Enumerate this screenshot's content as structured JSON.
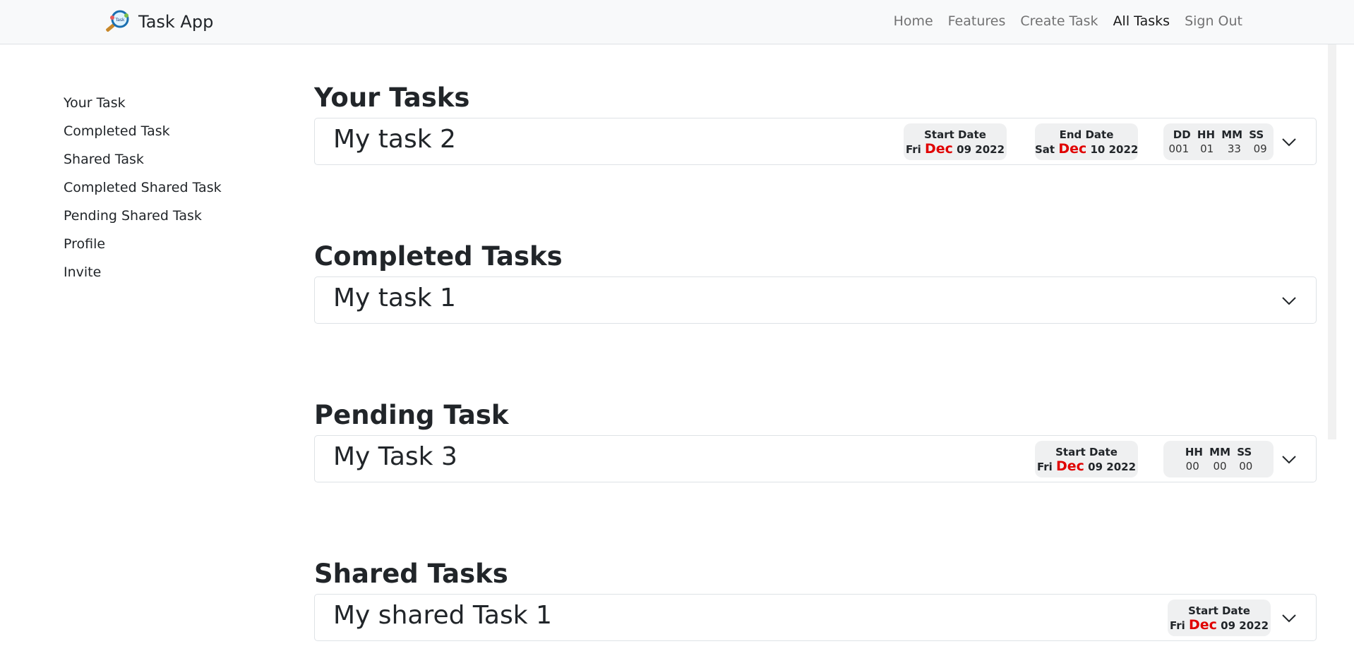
{
  "navbar": {
    "brand": "Task App",
    "links": [
      "Home",
      "Features",
      "Create Task",
      "All Tasks",
      "Sign Out"
    ],
    "active": "All Tasks"
  },
  "sidebar": {
    "items": [
      "Your Task",
      "Completed Task",
      "Shared Task",
      "Completed Shared Task",
      "Pending Shared Task",
      "Profile",
      "Invite"
    ]
  },
  "sections": {
    "your_tasks": {
      "heading": "Your Tasks",
      "task": {
        "title": "My task 2",
        "start": {
          "label": "Start Date",
          "day": "Fri",
          "month": "Dec",
          "rest": "09 2022"
        },
        "end": {
          "label": "End Date",
          "day": "Sat",
          "month": "Dec",
          "rest": "10 2022"
        },
        "countdown": {
          "headers": "DD HH MM SS",
          "dd": "001",
          "hh": "01",
          "mm": "33",
          "ss": "09"
        }
      }
    },
    "completed_tasks": {
      "heading": "Completed Tasks",
      "task": {
        "title": "My task 1"
      }
    },
    "pending_task": {
      "heading": "Pending Task",
      "task": {
        "title": "My Task 3",
        "start": {
          "label": "Start Date",
          "day": "Fri",
          "month": "Dec",
          "rest": "09 2022"
        },
        "countdown": {
          "headers": "HH MM SS",
          "hh": "00",
          "mm": "00",
          "ss": "00"
        }
      }
    },
    "shared_tasks": {
      "heading": "Shared Tasks",
      "task": {
        "title": "My shared Task 1",
        "start": {
          "label": "Start Date",
          "day": "Fri",
          "month": "Dec",
          "rest": "09 2022"
        }
      }
    }
  },
  "colors": {
    "month_accent": "#e00000",
    "pill_bg": "#eff0f1",
    "navbar_bg": "#f8f9fa"
  }
}
